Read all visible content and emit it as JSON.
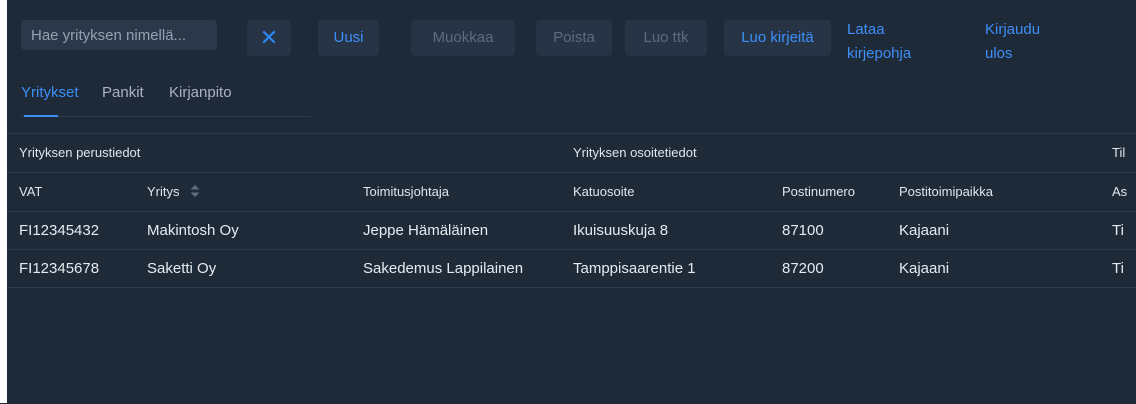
{
  "toolbar": {
    "search_placeholder": "Hae yrityksen nimellä...",
    "clear_symbol": "✕",
    "uusi": "Uusi",
    "muokkaa": "Muokkaa",
    "poista": "Poista",
    "luo_ttk": "Luo ttk",
    "luo_kirjeita": "Luo kirjeitä",
    "lataa_kirjepohja": "Lataa kirjepohja",
    "kirjaudu_ulos": "Kirjaudu ulos"
  },
  "tabs": [
    "Yritykset",
    "Pankit",
    "Kirjanpito"
  ],
  "table": {
    "groups": [
      "Yrityksen perustiedot",
      "Yrityksen osoitetiedot",
      "Til"
    ],
    "headers": [
      "VAT",
      "Yritys",
      "Toimitusjohtaja",
      "Katuosoite",
      "Postinumero",
      "Postitoimipaikka",
      "As"
    ],
    "rows": [
      [
        "FI12345432",
        "Makintosh Oy",
        "Jeppe Hämäläinen",
        "Ikuisuuskuja 8",
        "87100",
        "Kajaani",
        "Ti"
      ],
      [
        "FI12345678",
        "Saketti Oy",
        "Sakedemus Lappilainen",
        "Tamppisaarentie 1",
        "87200",
        "Kajaani",
        "Ti"
      ]
    ]
  },
  "colors": {
    "accent": "#3d8ff7",
    "background": "#1f2a38",
    "button": "#263446",
    "disabled": "#5b6a7e"
  },
  "icons": {
    "clear": "close-icon",
    "sort": "sort-icon"
  }
}
